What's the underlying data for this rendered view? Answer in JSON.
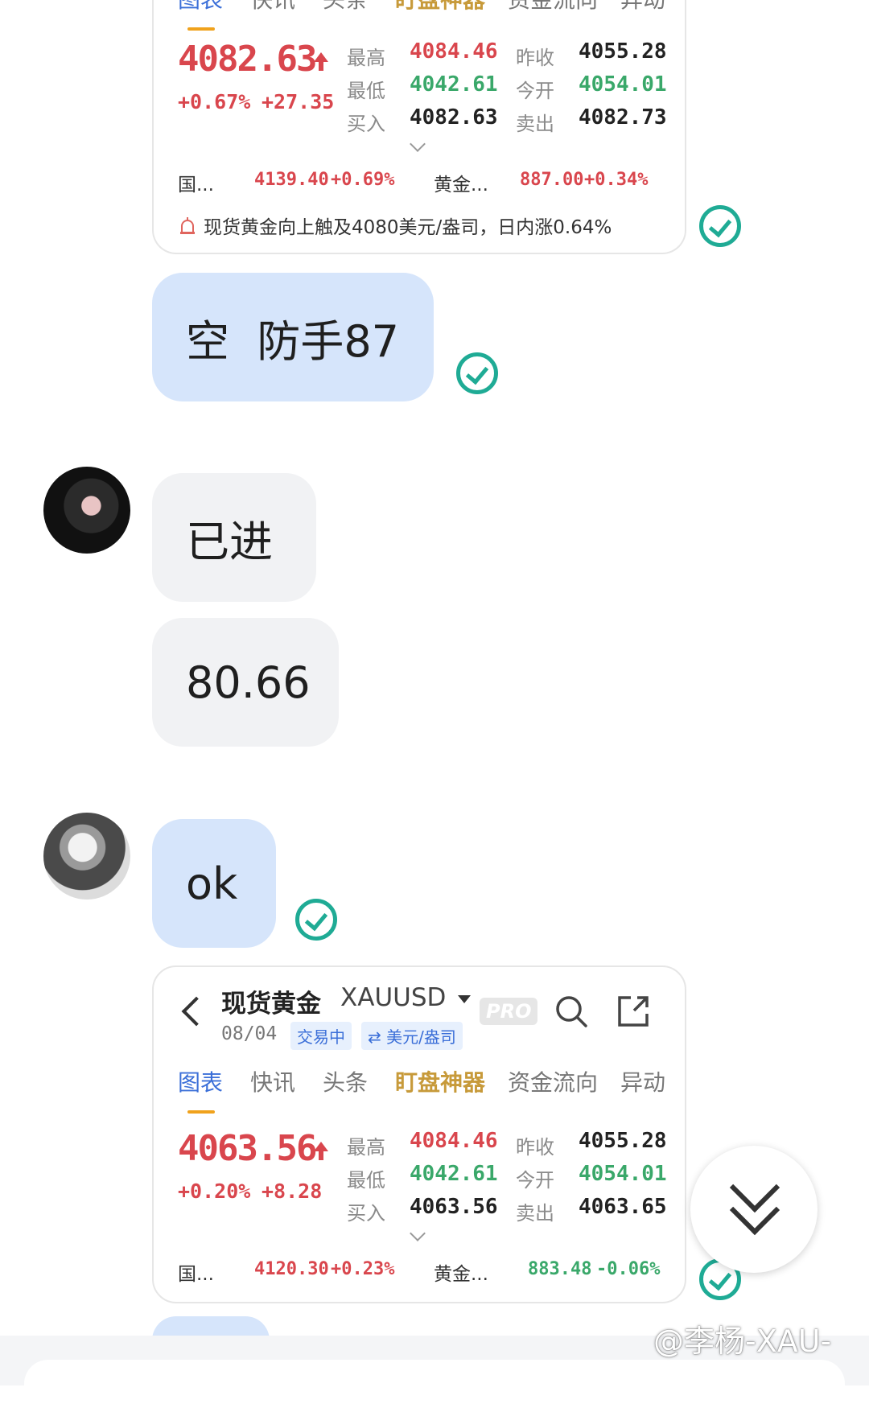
{
  "card1": {
    "tabs": [
      "图表",
      "快讯",
      "头条",
      "盯盘神器",
      "资金流向",
      "异动"
    ],
    "price": "4082.63",
    "change_pct": "+0.67%",
    "change_abs": "+27.35",
    "stats": {
      "high_label": "最高",
      "high_value": "4084.46",
      "low_label": "最低",
      "low_value": "4042.61",
      "bid_label": "买入",
      "bid_value": "4082.63",
      "prev_close_label": "昨收",
      "prev_close_value": "4055.28",
      "open_label": "今开",
      "open_value": "4054.01",
      "ask_label": "卖出",
      "ask_value": "4082.73"
    },
    "indices": [
      {
        "name": "国...",
        "value": "4139.40",
        "change": "+0.69%"
      },
      {
        "name": "黄金...",
        "value": "887.00",
        "change": "+0.34%"
      }
    ],
    "alert_text": "现货黄金向上触及4080美元/盎司，日内涨0.64%"
  },
  "messages": [
    {
      "text": "空  防手87"
    },
    {
      "text": "已进"
    },
    {
      "text": "80.66"
    },
    {
      "text": "ok"
    }
  ],
  "card2": {
    "title": "现货黄金",
    "symbol": "XAUUSD",
    "date": "08/04",
    "status_pill": "交易中",
    "unit_pill": "⇄ 美元/盎司",
    "pro_label": "PRO",
    "tabs": [
      "图表",
      "快讯",
      "头条",
      "盯盘神器",
      "资金流向",
      "异动"
    ],
    "price": "4063.56",
    "change_pct": "+0.20%",
    "change_abs": "+8.28",
    "stats": {
      "high_label": "最高",
      "high_value": "4084.46",
      "low_label": "最低",
      "low_value": "4042.61",
      "bid_label": "买入",
      "bid_value": "4063.56",
      "prev_close_label": "昨收",
      "prev_close_value": "4055.28",
      "open_label": "今开",
      "open_value": "4054.01",
      "ask_label": "卖出",
      "ask_value": "4063.65"
    },
    "indices": [
      {
        "name": "国...",
        "value": "4120.30",
        "change": "+0.23%"
      },
      {
        "name": "黄金...",
        "value": "883.48",
        "change": "-0.06%"
      }
    ]
  },
  "watermark": "@李杨-XAU-",
  "colors": {
    "up": "#d9464d",
    "down": "#3aa86a",
    "accent": "#3b6fd8",
    "read_check": "#1fab95",
    "my_bubble": "#d6e5fb"
  }
}
